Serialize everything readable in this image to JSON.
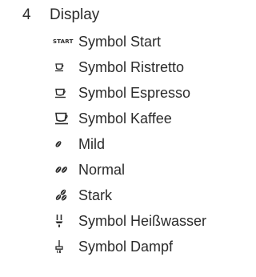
{
  "section": {
    "number": "4",
    "title": "Display"
  },
  "items": [
    {
      "icon": "start-text-icon",
      "icon_text": "START",
      "label": "Symbol Start"
    },
    {
      "icon": "cup-small-icon",
      "label": "Symbol Ristretto"
    },
    {
      "icon": "cup-medium-icon",
      "label": "Symbol Espresso"
    },
    {
      "icon": "cup-large-icon",
      "label": "Symbol Kaffee"
    },
    {
      "icon": "bean-one-icon",
      "label": "Mild"
    },
    {
      "icon": "bean-two-icon",
      "label": "Normal"
    },
    {
      "icon": "bean-three-icon",
      "label": "Stark"
    },
    {
      "icon": "hot-water-icon",
      "label": "Symbol Heißwasser"
    },
    {
      "icon": "steam-icon",
      "label": "Symbol Dampf"
    }
  ]
}
